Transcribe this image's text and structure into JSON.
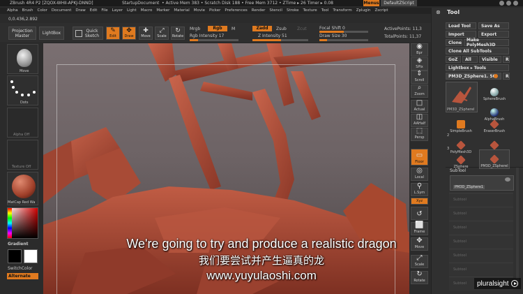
{
  "titlebar": {
    "title": "ZBrush 4R4 P2 [ZQOX-WHII-APKJ-DNND]",
    "document": "StartupDocument",
    "mem": "• Active Mem 383 • Scratch Disk 188 • Free Mem 3712 • ZTime ▸ 26 Timer ▸ 0.08",
    "menus_btn": "Menus",
    "script_btn": "DefaultZScript"
  },
  "menubar": [
    "Alpha",
    "Brush",
    "Color",
    "Document",
    "Draw",
    "Edit",
    "File",
    "Layer",
    "Light",
    "Macro",
    "Marker",
    "Material",
    "Movie",
    "Picker",
    "Preferences",
    "Render",
    "Stencil",
    "Stroke",
    "Texture",
    "Tool",
    "Transform",
    "Zplugin",
    "Zscript"
  ],
  "coords": "0,0.436,2.892",
  "toolbar": {
    "projection_master": "Projection Master",
    "lightbox": "LightBox",
    "quick_sketch": "Quick Sketch",
    "edit": "Edit",
    "draw": "Draw",
    "move": "Move",
    "scale": "Scale",
    "rotate": "Rotate",
    "mrgb": "Mrgb",
    "rgb": "Rgb",
    "m": "M",
    "rgb_intensity": "Rgb Intensity 17",
    "zadd": "Zadd",
    "zsub": "Zsub",
    "zcut": "Zcut",
    "z_intensity": "Z Intensity 51",
    "focal_shift": "Focal Shift 0",
    "draw_size": "Draw Size 30",
    "active_points": "ActivePoints: 11,3",
    "total_points": "TotalPoints: 11,37"
  },
  "left_panel": {
    "brush_label": "Move",
    "stroke_label": "Dots",
    "alpha_label": "Alpha  Off",
    "texture_label": "Texture  Off",
    "material_label": "MatCap Red Wa",
    "gradient": "Gradient",
    "switch_color": "SwitchColor",
    "alternate": "Alternate"
  },
  "right_strip": [
    "Bpr",
    "SPix",
    "Scroll",
    "Zoom",
    "Actual",
    "AAHalf",
    "Persp",
    "Floor",
    "Local",
    "L.Sym",
    "Xyz",
    "",
    "Frame",
    "Move",
    "Scale",
    "Rotate"
  ],
  "tool_panel": {
    "title": "Tool",
    "load_tool": "Load Tool",
    "save_as": "Save As",
    "import": "Import",
    "export": "Export",
    "clone": "Clone",
    "make_polymesh": "Make PolyMesh3D",
    "clone_all": "Clone All SubTools",
    "goz": "GoZ",
    "all": "All",
    "visible": "Visible",
    "r": "R",
    "lightbox_tools": "Lightbox ▸ Tools",
    "current_tool": "PM3D_ZSphere1. 50",
    "current_tool_r": "R",
    "brushes": [
      "PM3D_ZSpherel",
      "SphereBrush",
      "AlphaBrush",
      "SimpleBrush",
      "EraserBrush",
      "PolyMesh3D",
      "PolyMesh3D_1",
      "ZSphere",
      "PM3D_ZSpherel"
    ],
    "count_a": "2",
    "count_b": "3",
    "subtool": "SubTool",
    "subtool_item": "PM3D_ZSphere1",
    "subtool_empty": "Subtool"
  },
  "subtitles": {
    "en": "We're going to try and produce a realistic dragon",
    "zh": "我们要尝试并产生逼真的龙",
    "url": "www.yuyulaoshi.com"
  },
  "watermark": "pluralsight",
  "colors": {
    "accent": "#e07a1f",
    "model": "#b5533d",
    "ui_bg": "#2b2b2b"
  }
}
